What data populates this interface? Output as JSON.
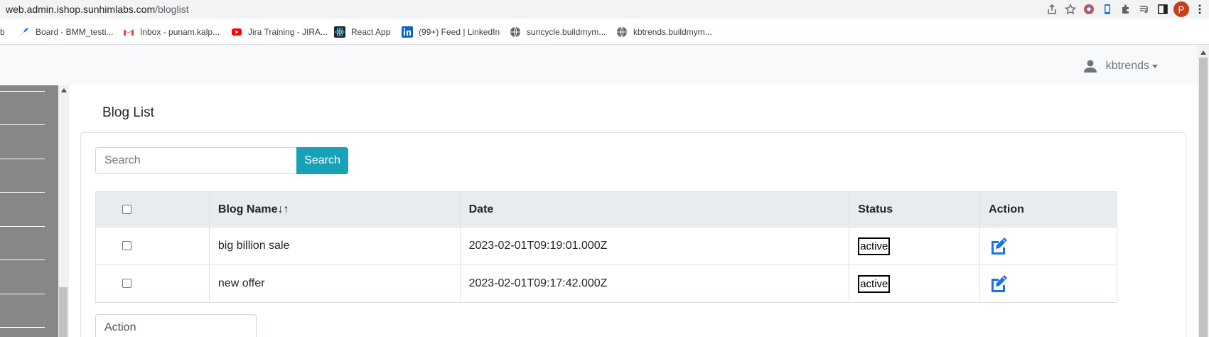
{
  "browser": {
    "url_host": "web.admin.ishop.sunhimlabs.com",
    "url_path": "/bloglist",
    "profile_initial": "P"
  },
  "bookmarks": [
    {
      "label": "b",
      "icon": "none"
    },
    {
      "label": "Board - BMM_testi...",
      "icon": "board-icon"
    },
    {
      "label": "Inbox - punam.kalp...",
      "icon": "gmail-icon"
    },
    {
      "label": "Jira Training - JIRA...",
      "icon": "youtube-icon"
    },
    {
      "label": "React App",
      "icon": "react-icon"
    },
    {
      "label": "(99+) Feed | LinkedIn",
      "icon": "linkedin-icon"
    },
    {
      "label": "suncycle.buildmym...",
      "icon": "globe-icon"
    },
    {
      "label": "kbtrends.buildmym...",
      "icon": "globe-icon"
    }
  ],
  "header": {
    "username": "kbtrends"
  },
  "page": {
    "title": "Blog List"
  },
  "search": {
    "placeholder": "Search",
    "button_label": "Search"
  },
  "table": {
    "columns": {
      "name": "Blog Name",
      "sort_arrows": "↓↑",
      "date": "Date",
      "status": "Status",
      "action": "Action"
    },
    "rows": [
      {
        "name": "big billion sale",
        "date": "2023-02-01T09:19:01.000Z",
        "status": "active"
      },
      {
        "name": "new offer",
        "date": "2023-02-01T09:17:42.000Z",
        "status": "active"
      }
    ]
  },
  "bulk_action": {
    "label": "Action"
  },
  "colors": {
    "accent": "#17a2b8",
    "edit_icon": "#1a73e8",
    "sidebar": "#878787"
  }
}
